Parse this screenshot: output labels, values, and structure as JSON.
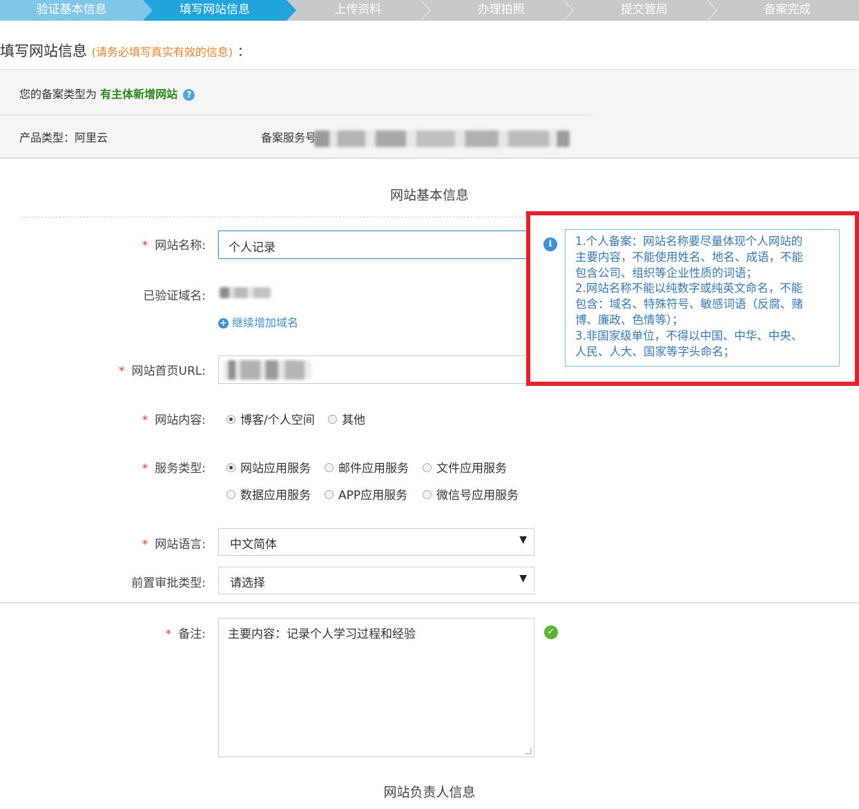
{
  "steps": [
    {
      "label": "验证基本信息",
      "state": "done"
    },
    {
      "label": "填写网站信息",
      "state": "active"
    },
    {
      "label": "上传资料",
      "state": "todo"
    },
    {
      "label": "办理拍照",
      "state": "todo"
    },
    {
      "label": "提交管局",
      "state": "todo"
    },
    {
      "label": "备案完成",
      "state": "todo"
    }
  ],
  "heading": {
    "title": "填写网站信息",
    "note": "(请务必填写真实有效的信息)",
    "colon": "："
  },
  "info": {
    "record_type_prefix": "您的备案类型为",
    "record_type": "有主体新增网站",
    "help_icon": "?",
    "product_type": "产品类型：阿里云",
    "service_label": "备案服务号："
  },
  "basic_section_title": "网站基本信息",
  "form": {
    "site_name": {
      "label": "网站名称:",
      "value": "个人记录"
    },
    "verified_domain": {
      "label": "已验证域名:"
    },
    "add_domain": {
      "icon": "+",
      "label": "继续增加域名"
    },
    "homepage_url": {
      "label": "网站首页URL:"
    },
    "content": {
      "label": "网站内容:",
      "options": [
        "博客/个人空间",
        "其他"
      ],
      "selected": "博客/个人空间"
    },
    "service_type": {
      "label": "服务类型:",
      "options": [
        "网站应用服务",
        "邮件应用服务",
        "文件应用服务",
        "数据应用服务",
        "APP应用服务",
        "微信号应用服务"
      ],
      "selected": "网站应用服务"
    },
    "language": {
      "label": "网站语言:",
      "value": "中文简体"
    },
    "pre_approval": {
      "label": "前置审批类型:",
      "value": "请选择"
    },
    "remark": {
      "label": "备注:",
      "value": "主要内容：记录个人学习过程和经验"
    }
  },
  "caret_glyph": "▼",
  "check_glyph": "✓",
  "info_glyph": "i",
  "tip": {
    "lines": [
      "1.个人备案：网站名称要尽量体现个人网站的",
      "主要内容，不能使用姓名、地名、成语，不能",
      "包含公司、组织等企业性质的词语；",
      "2.网站名称不能以纯数字或纯英文命名，不能",
      "包含：域名、特殊符号、敏感词语（反腐、赌",
      "博、廉政、色情等）；",
      "3.非国家级单位，不得以中国、中华、中央、",
      "人民、人大、国家等字头命名；"
    ]
  },
  "owner_section_title": "网站负责人信息",
  "colors": {
    "step_done": "#7fc7e8",
    "step_active": "#21a3dc",
    "step_todo": "#c8c8c8",
    "note_orange": "#e5832b",
    "highlight_green": "#2b8a18",
    "annotation_red": "#e4202a",
    "tip_blue": "#3578b8"
  }
}
